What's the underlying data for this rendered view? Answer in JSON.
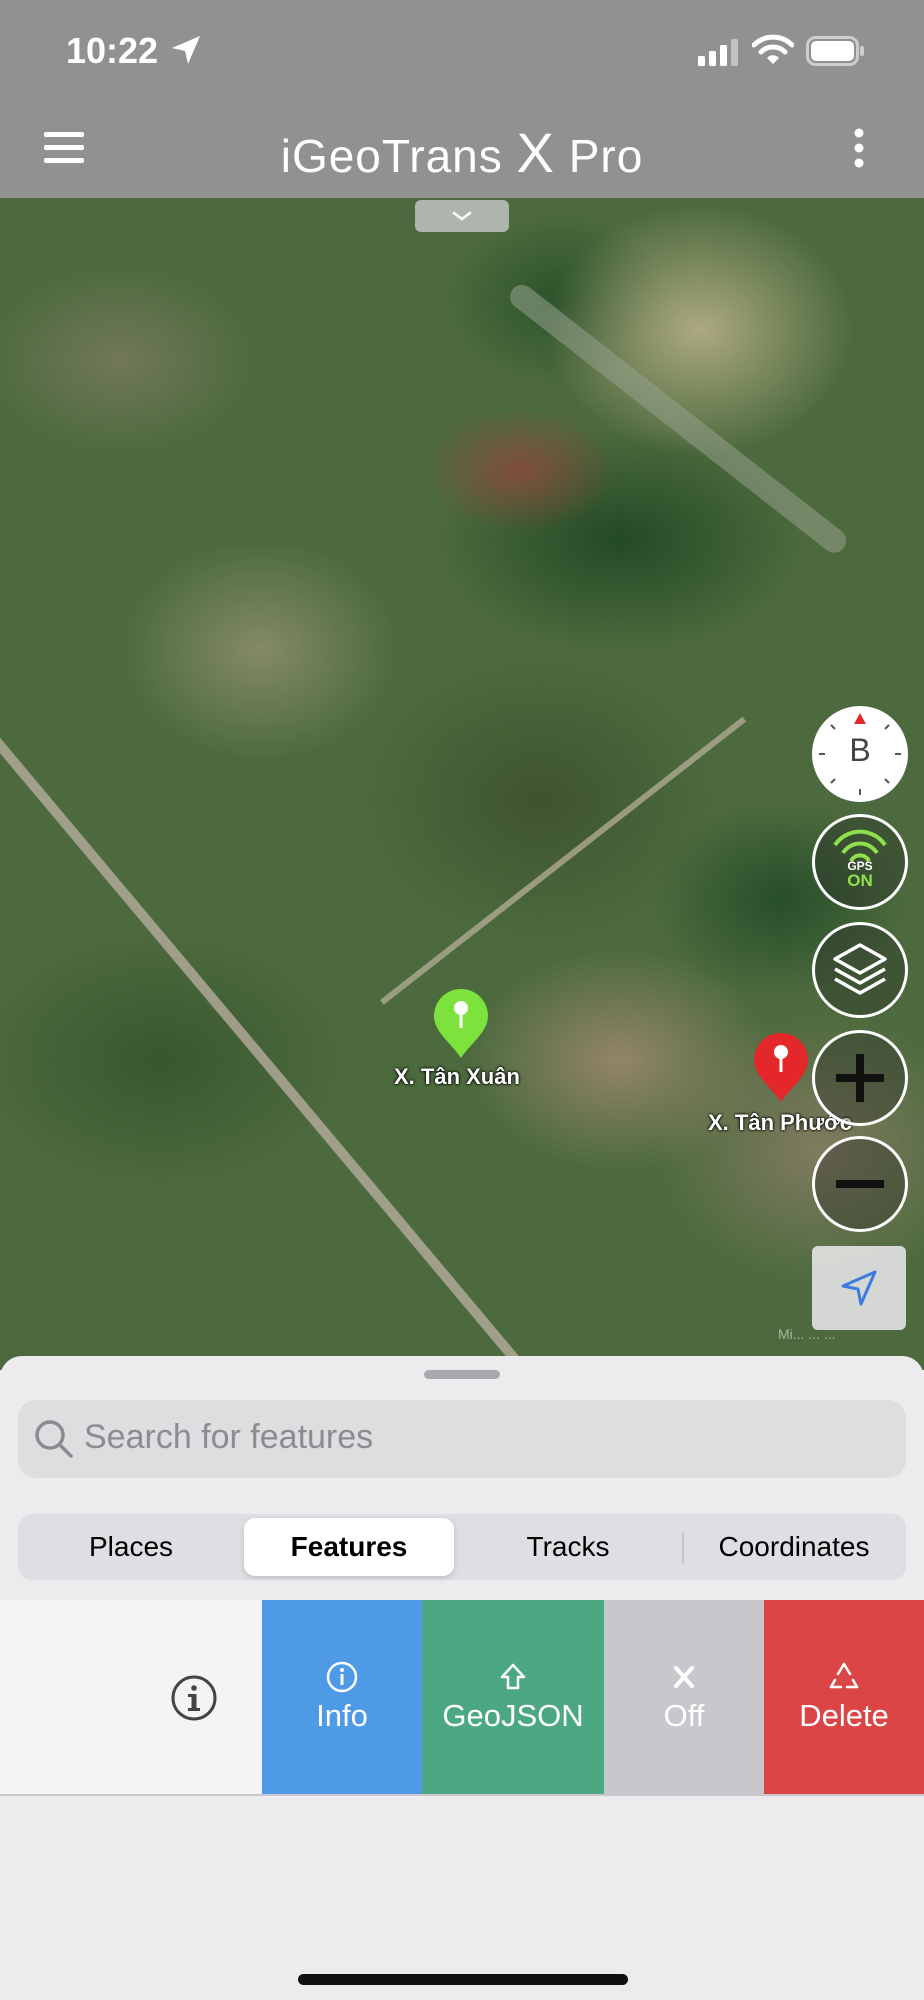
{
  "status_bar": {
    "time": "10:22"
  },
  "header": {
    "title_main": "iGeoTrans",
    "title_x": "X",
    "title_suffix": "Pro"
  },
  "map": {
    "markers": [
      {
        "label": "X. Tân Xuân",
        "color": "#7de23b"
      },
      {
        "label": "X. Tân Phước",
        "color": "#e3272a"
      }
    ],
    "compass_letter": "B",
    "gps_label": "GPS",
    "gps_state": "ON",
    "attribution": "Mi... ... ..."
  },
  "sheet": {
    "search_placeholder": "Search for features",
    "tabs": [
      {
        "label": "Places",
        "active": false
      },
      {
        "label": "Features",
        "active": true
      },
      {
        "label": "Tracks",
        "active": false
      },
      {
        "label": "Coordinates",
        "active": false
      }
    ],
    "row_actions": [
      {
        "label": "Info",
        "icon": "info-icon",
        "color": "#4f9ae6"
      },
      {
        "label": "GeoJSON",
        "icon": "upload-icon",
        "color": "#4ca882"
      },
      {
        "label": "Off",
        "icon": "x-icon",
        "color": "#c7c7cc"
      },
      {
        "label": "Delete",
        "icon": "recycle-icon",
        "color": "#dc4545"
      }
    ]
  }
}
